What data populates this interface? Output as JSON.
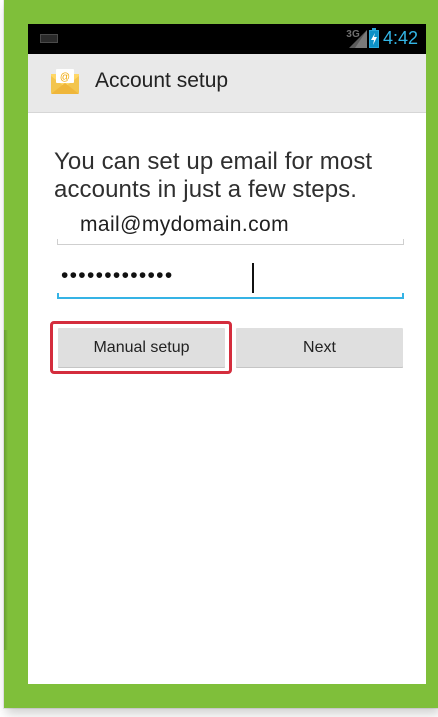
{
  "status_bar": {
    "network": "3G",
    "time": "4:42",
    "accent_color": "#33b5e5"
  },
  "action_bar": {
    "icon": "email-envelope-icon",
    "title": "Account setup"
  },
  "form": {
    "intro_text": "You can set up email for most accounts in just a few steps.",
    "email_value": "mail@mydomain.com",
    "password_mask": "•••••••••••••",
    "focus_color": "#35b3e5"
  },
  "buttons": {
    "manual_label": "Manual setup",
    "next_label": "Next"
  },
  "frame": {
    "border_color": "#7fbf3a",
    "highlight_color": "#d42d3d"
  }
}
